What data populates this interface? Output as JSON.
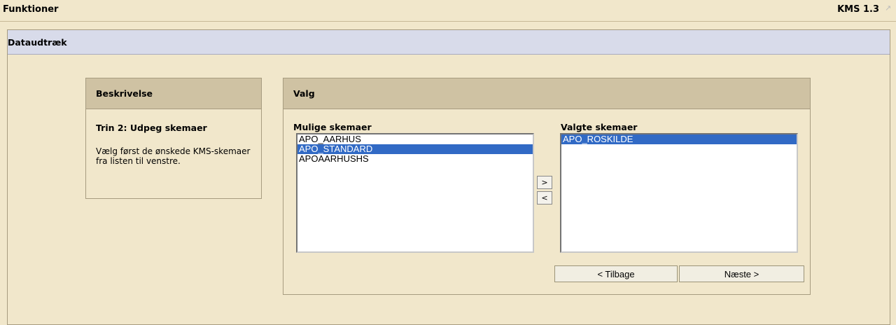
{
  "topbar": {
    "title": "Funktioner",
    "version": "KMS 1.3"
  },
  "panel": {
    "title": "Dataudtræk"
  },
  "description": {
    "header": "Beskrivelse",
    "step": "Trin 2: Udpeg skemaer",
    "text": "Vælg først de ønskede KMS-skemaer fra listen til venstre."
  },
  "selection": {
    "header": "Valg",
    "available_label": "Mulige skemaer",
    "selected_label": "Valgte skemaer",
    "available": [
      {
        "label": "APO_AARHUS",
        "selected": false
      },
      {
        "label": "APO_STANDARD",
        "selected": true
      },
      {
        "label": "APOAARHUSHS",
        "selected": false
      }
    ],
    "chosen": [
      {
        "label": "APO_ROSKILDE",
        "selected": true
      }
    ],
    "add_label": ">",
    "remove_label": "<",
    "back_label": "< Tilbage",
    "next_label": "Næste >"
  }
}
